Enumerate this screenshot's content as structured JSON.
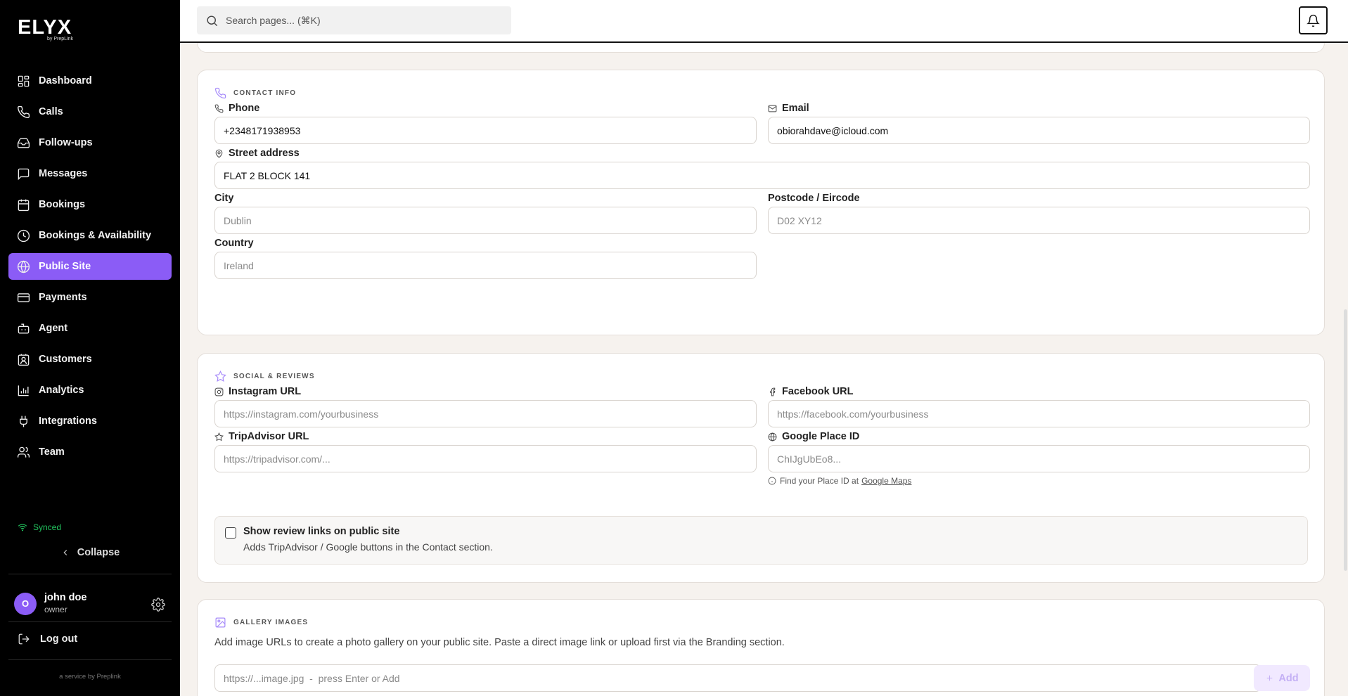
{
  "sidebar": {
    "logo": "ELYX",
    "logo_sub": "by PrepLink",
    "items": [
      {
        "label": "Dashboard"
      },
      {
        "label": "Calls"
      },
      {
        "label": "Follow-ups"
      },
      {
        "label": "Messages"
      },
      {
        "label": "Bookings"
      },
      {
        "label": "Bookings & Availability"
      },
      {
        "label": "Public Site"
      },
      {
        "label": "Payments"
      },
      {
        "label": "Agent"
      },
      {
        "label": "Customers"
      },
      {
        "label": "Analytics"
      },
      {
        "label": "Integrations"
      },
      {
        "label": "Team"
      }
    ],
    "active_item": "Public Site",
    "status": "Synced",
    "collapse": "Collapse",
    "user": {
      "initial": "O",
      "name": "john doe",
      "role": "owner"
    },
    "logout": "Log out",
    "footer": "a service by Preplink"
  },
  "topbar": {
    "search_placeholder": "Search pages... (⌘K)"
  },
  "contact": {
    "title": "CONTACT INFO",
    "phone_label": "Phone",
    "phone_value": "+2348171938953",
    "email_label": "Email",
    "email_value": "obiorahdave@icloud.com",
    "street_label": "Street address",
    "street_value": "FLAT 2 BLOCK 141",
    "city_label": "City",
    "city_placeholder": "Dublin",
    "postcode_label": "Postcode / Eircode",
    "postcode_placeholder": "D02 XY12",
    "country_label": "Country",
    "country_placeholder": "Ireland"
  },
  "social": {
    "title": "SOCIAL & REVIEWS",
    "instagram_label": "Instagram URL",
    "instagram_placeholder": "https://instagram.com/yourbusiness",
    "facebook_label": "Facebook URL",
    "facebook_placeholder": "https://facebook.com/yourbusiness",
    "tripadvisor_label": "TripAdvisor URL",
    "tripadvisor_placeholder": "https://tripadvisor.com/...",
    "google_label": "Google Place ID",
    "google_placeholder": "ChIJgUbEo8...",
    "hint_text": "Find your Place ID at",
    "hint_link": "Google Maps",
    "review_title": "Show review links on public site",
    "review_sub": "Adds TripAdvisor / Google buttons in the Contact section.",
    "review_checked": false
  },
  "gallery": {
    "title": "GALLERY IMAGES",
    "description": "Add image URLs to create a photo gallery on your public site. Paste a direct image link or upload first via the Branding section.",
    "input_placeholder": "https://...image.jpg  -  press Enter or Add",
    "add_label": "Add"
  }
}
